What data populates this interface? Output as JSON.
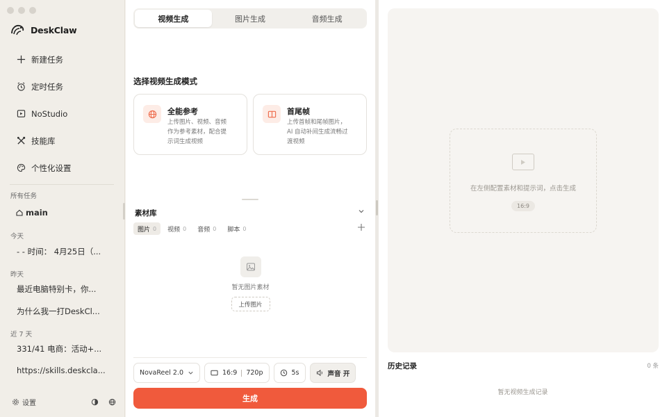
{
  "app": {
    "name": "DeskClaw"
  },
  "sidebar": {
    "nav": [
      {
        "label": "新建任务",
        "icon": "plus-icon"
      },
      {
        "label": "定时任务",
        "icon": "alarm-icon"
      },
      {
        "label": "NoStudio",
        "icon": "play-square-icon"
      },
      {
        "label": "技能库",
        "icon": "tools-icon"
      },
      {
        "label": "个性化设置",
        "icon": "palette-icon"
      }
    ],
    "sections": {
      "all_tasks": "所有任务",
      "today": "今天",
      "yesterday": "昨天",
      "last7": "近 7 天"
    },
    "main_item": "main",
    "today_items": [
      "- - 时间： 4月25日（..."
    ],
    "yesterday_items": [
      "最近电脑特别卡，你...",
      "为什么我一打DeskCl..."
    ],
    "last7_items": [
      "331/41 电商：活动+...",
      "https://skills.deskcla..."
    ],
    "footer": {
      "settings": "设置"
    }
  },
  "panel": {
    "tabs": [
      "视频生成",
      "图片生成",
      "音频生成"
    ],
    "active_tab": 0,
    "mode_title": "选择视频生成模式",
    "modes": [
      {
        "title": "全能参考",
        "desc": "上传图片、视频、音频作为参考素材，配合提示词生成视频",
        "icon": "globe-icon"
      },
      {
        "title": "首尾帧",
        "desc": "上传首帧和尾帧图片，AI 自动补间生成流畅过渡视频",
        "icon": "frames-icon"
      }
    ],
    "library": {
      "title": "素材库",
      "tabs": [
        {
          "label": "图片",
          "count": "0"
        },
        {
          "label": "视频",
          "count": "0"
        },
        {
          "label": "音频",
          "count": "0"
        },
        {
          "label": "脚本",
          "count": "0"
        }
      ],
      "empty_text": "暂无图片素材",
      "upload_label": "上传图片"
    },
    "controls": {
      "model": "NovaReel 2.0",
      "ratio": "16:9",
      "resolution": "720p",
      "duration": "5s",
      "sound": "声音 开"
    },
    "generate_label": "生成"
  },
  "preview": {
    "hint": "在左侧配置素材和提示词，点击生成",
    "ratio": "16:9",
    "history_title": "历史记录",
    "history_count": "0 条",
    "history_empty": "暂无视频生成记录"
  },
  "colors": {
    "accent": "#f05a3c",
    "sidebar_bg": "#f1eee8",
    "icon_tint": "#ee6a4a"
  }
}
